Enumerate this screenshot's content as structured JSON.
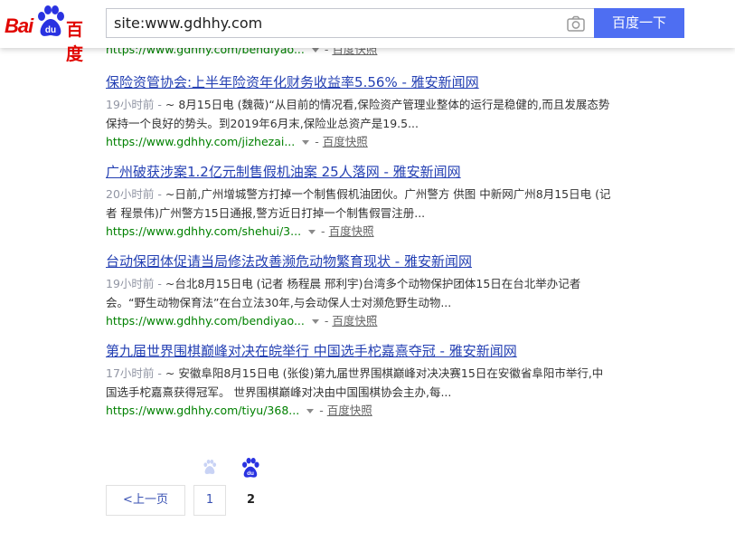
{
  "header": {
    "logo_latin": "Bai",
    "logo_du": "du",
    "logo_cn": "百度",
    "query": "site:www.gdhhy.com",
    "search_button": "百度一下"
  },
  "results": [
    {
      "url": "https://www.gdhhy.com/bendiyao...",
      "url_sep": "-",
      "snapshot": "百度快照"
    },
    {
      "title": "保险资管协会:上半年险资年化财务收益率5.56% - 雅安新闻网",
      "time": "19小时前 -",
      "abstract": "~ 8月15日电 (魏薇)“从目前的情况看,保险资产管理业整体的运行是稳健的,而且发展态势保持一个良好的势头。到2019年6月末,保险业总资产是19.5...",
      "url": "https://www.gdhhy.com/jizhezai...",
      "url_sep": "-",
      "snapshot": "百度快照"
    },
    {
      "title": "广州破获涉案1.2亿元制售假机油案 25人落网 - 雅安新闻网",
      "time": "20小时前 -",
      "abstract": "~日前,广州增城警方打掉一个制售假机油团伙。广州警方 供图 中新网广州8月15日电 (记者 程景伟)广州警方15日通报,警方近日打掉一个制售假冒注册...",
      "url": "https://www.gdhhy.com/shehui/3...",
      "url_sep": "-",
      "snapshot": "百度快照"
    },
    {
      "title": "台动保团体促请当局修法改善濒危动物繁育现状 - 雅安新闻网",
      "time": "19小时前 -",
      "abstract": "~台北8月15日电 (记者 杨程晨 邢利宇)台湾多个动物保护团体15日在台北举办记者会。“野生动物保育法”在台立法30年,与会动保人士对濒危野生动物...",
      "url": "https://www.gdhhy.com/bendiyao...",
      "url_sep": "-",
      "snapshot": "百度快照"
    },
    {
      "title": "第九届世界围棋巅峰对决在皖举行 中国选手柁嘉熹夺冠 - 雅安新闻网",
      "time": "17小时前 -",
      "abstract": "~ 安徽阜阳8月15日电 (张俊)第九届世界围棋巅峰对决决赛15日在安徽省阜阳市举行,中国选手柁嘉熹获得冠军。 世界围棋巅峰对决由中国围棋协会主办,每...",
      "url": "https://www.gdhhy.com/tiyu/368...",
      "url_sep": "-",
      "snapshot": "百度快照"
    }
  ],
  "pagination": {
    "prev_label": "<上一页",
    "pages": [
      "1",
      "2"
    ],
    "current": "2"
  },
  "colors": {
    "brand_red": "#e10601",
    "brand_blue": "#4e6ef2",
    "link_blue": "#2440b3",
    "url_green": "#008000"
  },
  "icons": [
    "baidu-paw-icon",
    "camera-icon",
    "dropdown-arrow-icon",
    "pager-paw-icon"
  ]
}
